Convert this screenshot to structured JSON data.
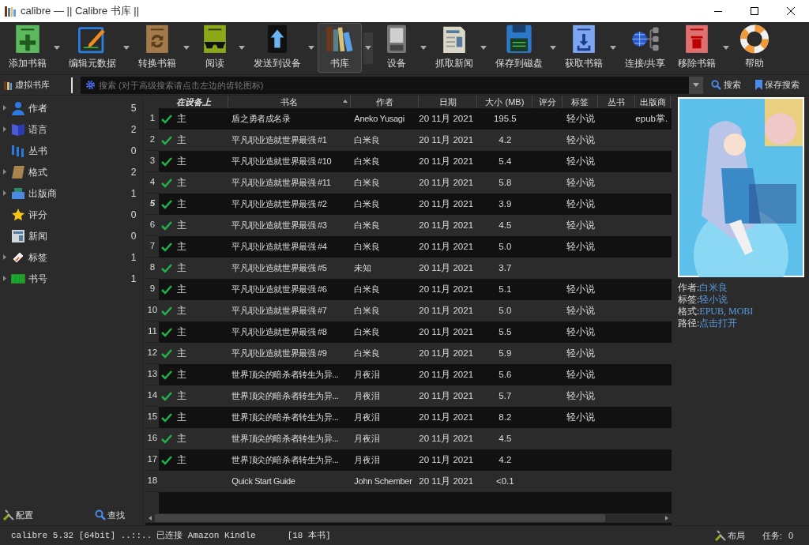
{
  "window": {
    "title": "calibre — || Calibre 书库 ||"
  },
  "toolbar": [
    {
      "label": "添加书籍",
      "kind": "add",
      "has_menu": true,
      "selected": false
    },
    {
      "label": "编辑元数据",
      "kind": "edit",
      "has_menu": true,
      "selected": false
    },
    {
      "label": "转换书籍",
      "kind": "convert",
      "has_menu": true,
      "selected": false
    },
    {
      "label": "阅读",
      "kind": "read",
      "has_menu": true,
      "selected": false
    },
    {
      "label": "发送到设备",
      "kind": "send",
      "has_menu": true,
      "selected": false
    },
    {
      "label": "书库",
      "kind": "library",
      "has_menu": true,
      "selected": true
    },
    {
      "label": "设备",
      "kind": "device",
      "has_menu": true,
      "selected": false
    },
    {
      "label": "抓取新闻",
      "kind": "news",
      "has_menu": true,
      "selected": false
    },
    {
      "label": "保存到磁盘",
      "kind": "save",
      "has_menu": true,
      "selected": false
    },
    {
      "label": "获取书籍",
      "kind": "get",
      "has_menu": true,
      "selected": false
    },
    {
      "label": "连接/共享",
      "kind": "share",
      "has_menu": false,
      "selected": false
    },
    {
      "label": "移除书籍",
      "kind": "remove",
      "has_menu": true,
      "selected": false
    },
    {
      "label": "帮助",
      "kind": "help",
      "has_menu": false,
      "selected": false
    }
  ],
  "search_row": {
    "virtual_library": "虚拟书库",
    "placeholder": "搜索 (对于高级搜索请点击左边的齿轮图标)",
    "search_button": "搜索",
    "save_search": "保存搜索"
  },
  "sidebar": {
    "items": [
      {
        "label": "作者",
        "count": "5",
        "kind": "person",
        "expandable": true
      },
      {
        "label": "语言",
        "count": "2",
        "kind": "language",
        "expandable": true
      },
      {
        "label": "丛书",
        "count": "0",
        "kind": "series",
        "expandable": false
      },
      {
        "label": "格式",
        "count": "2",
        "kind": "format",
        "expandable": true
      },
      {
        "label": "出版商",
        "count": "1",
        "kind": "publisher",
        "expandable": true
      },
      {
        "label": "评分",
        "count": "0",
        "kind": "star",
        "expandable": false
      },
      {
        "label": "新闻",
        "count": "0",
        "kind": "news",
        "expandable": false
      },
      {
        "label": "标签",
        "count": "1",
        "kind": "tag",
        "expandable": true
      },
      {
        "label": "书号",
        "count": "1",
        "kind": "barcode",
        "expandable": true
      }
    ],
    "configure": "配置",
    "find": "查找"
  },
  "table": {
    "columns": [
      "在设备上",
      "书名",
      "作者",
      "日期",
      "大小 (MB)",
      "评分",
      "标签",
      "丛书",
      "出版商"
    ],
    "rows": [
      {
        "num": "1",
        "on_device": true,
        "device": "主",
        "title": "盾之勇者成名录",
        "author": "Aneko Yusagi",
        "date": "20 11月 2021",
        "size": "195.5",
        "tags": "轻小说",
        "publisher": "epub掌.",
        "current": false
      },
      {
        "num": "2",
        "on_device": true,
        "device": "主",
        "title": "平凡职业造就世界最强 #1",
        "author": "白米良",
        "date": "20 11月 2021",
        "size": "4.2",
        "tags": "轻小说",
        "current": false
      },
      {
        "num": "3",
        "on_device": true,
        "device": "主",
        "title": "平凡职业造就世界最强 #10",
        "author": "白米良",
        "date": "20 11月 2021",
        "size": "5.4",
        "tags": "轻小说",
        "current": false
      },
      {
        "num": "4",
        "on_device": true,
        "device": "主",
        "title": "平凡职业造就世界最强 #11",
        "author": "白米良",
        "date": "20 11月 2021",
        "size": "5.8",
        "tags": "轻小说",
        "current": false
      },
      {
        "num": "5",
        "on_device": true,
        "device": "主",
        "title": "平凡职业造就世界最强 #2",
        "author": "白米良",
        "date": "20 11月 2021",
        "size": "3.9",
        "tags": "轻小说",
        "current": true
      },
      {
        "num": "6",
        "on_device": true,
        "device": "主",
        "title": "平凡职业造就世界最强 #3",
        "author": "白米良",
        "date": "20 11月 2021",
        "size": "4.5",
        "tags": "轻小说",
        "current": false
      },
      {
        "num": "7",
        "on_device": true,
        "device": "主",
        "title": "平凡职业造就世界最强 #4",
        "author": "白米良",
        "date": "20 11月 2021",
        "size": "5.0",
        "tags": "轻小说",
        "current": false
      },
      {
        "num": "8",
        "on_device": true,
        "device": "主",
        "title": "平凡职业造就世界最强 #5",
        "author": "未知",
        "date": "20 11月 2021",
        "size": "3.7",
        "current": false
      },
      {
        "num": "9",
        "on_device": true,
        "device": "主",
        "title": "平凡职业造就世界最强 #6",
        "author": "白米良",
        "date": "20 11月 2021",
        "size": "5.1",
        "tags": "轻小说",
        "current": false
      },
      {
        "num": "10",
        "on_device": true,
        "device": "主",
        "title": "平凡职业造就世界最强 #7",
        "author": "白米良",
        "date": "20 11月 2021",
        "size": "5.0",
        "tags": "轻小说",
        "current": false
      },
      {
        "num": "11",
        "on_device": true,
        "device": "主",
        "title": "平凡职业造就世界最强 #8",
        "author": "白米良",
        "date": "20 11月 2021",
        "size": "5.5",
        "tags": "轻小说",
        "current": false
      },
      {
        "num": "12",
        "on_device": true,
        "device": "主",
        "title": "平凡职业造就世界最强 #9",
        "author": "白米良",
        "date": "20 11月 2021",
        "size": "5.9",
        "tags": "轻小说",
        "current": false
      },
      {
        "num": "13",
        "on_device": true,
        "device": "主",
        "title": "世界顶尖的暗杀者转生为异...",
        "author": "月夜泪",
        "date": "20 11月 2021",
        "size": "5.6",
        "tags": "轻小说",
        "current": false
      },
      {
        "num": "14",
        "on_device": true,
        "device": "主",
        "title": "世界顶尖的暗杀者转生为异...",
        "author": "月夜泪",
        "date": "20 11月 2021",
        "size": "5.7",
        "tags": "轻小说",
        "current": false
      },
      {
        "num": "15",
        "on_device": true,
        "device": "主",
        "title": "世界顶尖的暗杀者转生为异...",
        "author": "月夜泪",
        "date": "20 11月 2021",
        "size": "8.2",
        "tags": "轻小说",
        "current": false
      },
      {
        "num": "16",
        "on_device": true,
        "device": "主",
        "title": "世界顶尖的暗杀者转生为异...",
        "author": "月夜泪",
        "date": "20 11月 2021",
        "size": "4.5",
        "current": false
      },
      {
        "num": "17",
        "on_device": true,
        "device": "主",
        "title": "世界顶尖的暗杀者转生为异...",
        "author": "月夜泪",
        "date": "20 11月 2021",
        "size": "4.2",
        "current": false
      },
      {
        "num": "18",
        "on_device": false,
        "title": "Quick Start Guide",
        "author": "John Schember",
        "date": "20 11月 2021",
        "size": "<0.1",
        "current": false
      }
    ]
  },
  "details": {
    "fields": [
      {
        "label": "作者:",
        "value": "白米良"
      },
      {
        "label": "标签:",
        "value": "轻小说"
      },
      {
        "label": "格式:",
        "value": "EPUB, MOBI"
      },
      {
        "label": "路径:",
        "value": "点击打开"
      }
    ]
  },
  "status_bar": {
    "version": "calibre 5.32 [64bit] ..::..",
    "connected": "已连接 Amazon Kindle",
    "count": "[18 本书]",
    "layout": "布局",
    "jobs_label": "任务:",
    "jobs": "0"
  }
}
